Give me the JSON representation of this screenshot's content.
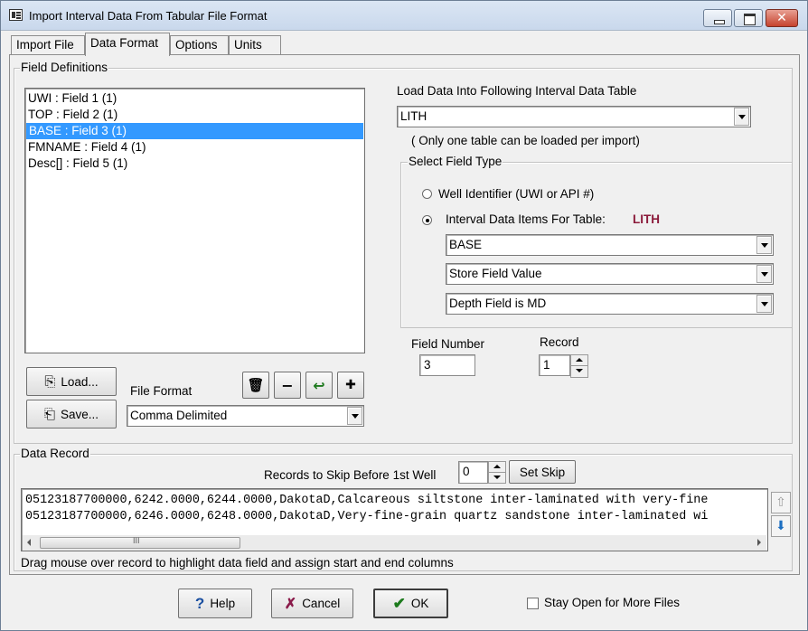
{
  "window": {
    "title": "Import Interval Data From Tabular File Format"
  },
  "tabs": [
    {
      "label": "Import File"
    },
    {
      "label": "Data Format"
    },
    {
      "label": "Options"
    },
    {
      "label": "Units"
    }
  ],
  "field_definitions": {
    "group_label": "Field Definitions",
    "items": [
      {
        "label": "UWI : Field 1 (1)"
      },
      {
        "label": "TOP : Field 2 (1)"
      },
      {
        "label": "BASE : Field 3 (1)",
        "selected": true
      },
      {
        "label": "FMNAME : Field 4 (1)"
      },
      {
        "label": "Desc[] : Field 5 (1)"
      }
    ]
  },
  "load_table": {
    "label": "Load Data Into Following Interval Data Table",
    "value": "LITH",
    "note": "( Only one table can be loaded per import)"
  },
  "field_type": {
    "group_label": "Select Field Type",
    "radio_well_label": "Well Identifier (UWI or API #)",
    "radio_interval_label": "Interval Data Items For Table:",
    "table_name": "LITH",
    "table_name_color": "#8b1a3a",
    "item_combo": "BASE",
    "store_combo": "Store Field Value",
    "depth_combo": "Depth Field is MD"
  },
  "field_number": {
    "label": "Field Number",
    "value": "3"
  },
  "record": {
    "label": "Record",
    "value": "1"
  },
  "buttons": {
    "load": "Load...",
    "save": "Save..."
  },
  "file_format": {
    "label": "File Format",
    "value": "Comma Delimited"
  },
  "data_record": {
    "group_label": "Data Record",
    "skip_label": "Records to Skip Before 1st Well",
    "skip_value": "0",
    "set_skip_label": "Set Skip",
    "lines": [
      "05123187700000,6242.0000,6244.0000,DakotaD,Calcareous siltstone inter-laminated with very-fine",
      "05123187700000,6246.0000,6248.0000,DakotaD,Very-fine-grain quartz sandstone inter-laminated wi"
    ],
    "hint": "Drag mouse over record to highlight data field and assign start and end columns"
  },
  "footer": {
    "help": "Help",
    "cancel": "Cancel",
    "ok": "OK",
    "stay_open": "Stay Open for More Files"
  }
}
